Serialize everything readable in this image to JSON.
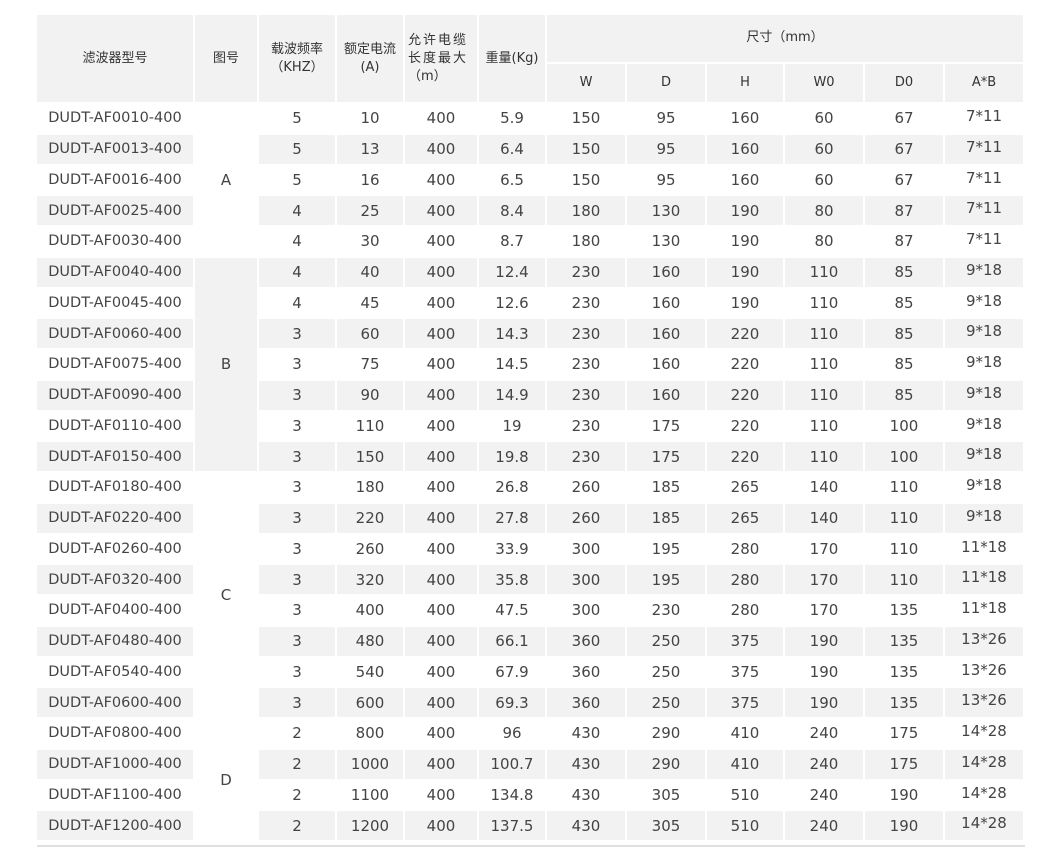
{
  "header": {
    "model": "滤波器型号",
    "figure": "图号",
    "carrier_freq": [
      "载波频率",
      "（KHZ）"
    ],
    "rated_current": [
      "额定电流",
      "(A)"
    ],
    "cable_length": [
      "允许电缆",
      "长度最大",
      "（m）"
    ],
    "weight": "重量(Kg)",
    "dimensions": "尺寸（mm）",
    "dim_cols": [
      "W",
      "D",
      "H",
      "W0",
      "D0",
      "A*B"
    ]
  },
  "groups": [
    {
      "label": "A",
      "start": 0,
      "span": 5
    },
    {
      "label": "B",
      "start": 5,
      "span": 7
    },
    {
      "label": "C",
      "start": 12,
      "span": 8
    },
    {
      "label": "D",
      "start": 20,
      "span": 4
    }
  ],
  "rows": [
    {
      "model": "DUDT-AF0010-400",
      "freq": "5",
      "current": "10",
      "cable": "400",
      "weight": "5.9",
      "W": "150",
      "D": "95",
      "H": "160",
      "W0": "60",
      "D0": "67",
      "AB": "7*11"
    },
    {
      "model": "DUDT-AF0013-400",
      "freq": "5",
      "current": "13",
      "cable": "400",
      "weight": "6.4",
      "W": "150",
      "D": "95",
      "H": "160",
      "W0": "60",
      "D0": "67",
      "AB": "7*11"
    },
    {
      "model": "DUDT-AF0016-400",
      "freq": "5",
      "current": "16",
      "cable": "400",
      "weight": "6.5",
      "W": "150",
      "D": "95",
      "H": "160",
      "W0": "60",
      "D0": "67",
      "AB": "7*11"
    },
    {
      "model": "DUDT-AF0025-400",
      "freq": "4",
      "current": "25",
      "cable": "400",
      "weight": "8.4",
      "W": "180",
      "D": "130",
      "H": "190",
      "W0": "80",
      "D0": "87",
      "AB": "7*11"
    },
    {
      "model": "DUDT-AF0030-400",
      "freq": "4",
      "current": "30",
      "cable": "400",
      "weight": "8.7",
      "W": "180",
      "D": "130",
      "H": "190",
      "W0": "80",
      "D0": "87",
      "AB": "7*11"
    },
    {
      "model": "DUDT-AF0040-400",
      "freq": "4",
      "current": "40",
      "cable": "400",
      "weight": "12.4",
      "W": "230",
      "D": "160",
      "H": "190",
      "W0": "110",
      "D0": "85",
      "AB": "9*18"
    },
    {
      "model": "DUDT-AF0045-400",
      "freq": "4",
      "current": "45",
      "cable": "400",
      "weight": "12.6",
      "W": "230",
      "D": "160",
      "H": "190",
      "W0": "110",
      "D0": "85",
      "AB": "9*18"
    },
    {
      "model": "DUDT-AF0060-400",
      "freq": "3",
      "current": "60",
      "cable": "400",
      "weight": "14.3",
      "W": "230",
      "D": "160",
      "H": "220",
      "W0": "110",
      "D0": "85",
      "AB": "9*18"
    },
    {
      "model": "DUDT-AF0075-400",
      "freq": "3",
      "current": "75",
      "cable": "400",
      "weight": "14.5",
      "W": "230",
      "D": "160",
      "H": "220",
      "W0": "110",
      "D0": "85",
      "AB": "9*18"
    },
    {
      "model": "DUDT-AF0090-400",
      "freq": "3",
      "current": "90",
      "cable": "400",
      "weight": "14.9",
      "W": "230",
      "D": "160",
      "H": "220",
      "W0": "110",
      "D0": "85",
      "AB": "9*18"
    },
    {
      "model": "DUDT-AF0110-400",
      "freq": "3",
      "current": "110",
      "cable": "400",
      "weight": "19",
      "W": "230",
      "D": "175",
      "H": "220",
      "W0": "110",
      "D0": "100",
      "AB": "9*18"
    },
    {
      "model": "DUDT-AF0150-400",
      "freq": "3",
      "current": "150",
      "cable": "400",
      "weight": "19.8",
      "W": "230",
      "D": "175",
      "H": "220",
      "W0": "110",
      "D0": "100",
      "AB": "9*18"
    },
    {
      "model": "DUDT-AF0180-400",
      "freq": "3",
      "current": "180",
      "cable": "400",
      "weight": "26.8",
      "W": "260",
      "D": "185",
      "H": "265",
      "W0": "140",
      "D0": "110",
      "AB": "9*18"
    },
    {
      "model": "DUDT-AF0220-400",
      "freq": "3",
      "current": "220",
      "cable": "400",
      "weight": "27.8",
      "W": "260",
      "D": "185",
      "H": "265",
      "W0": "140",
      "D0": "110",
      "AB": "9*18"
    },
    {
      "model": "DUDT-AF0260-400",
      "freq": "3",
      "current": "260",
      "cable": "400",
      "weight": "33.9",
      "W": "300",
      "D": "195",
      "H": "280",
      "W0": "170",
      "D0": "110",
      "AB": "11*18"
    },
    {
      "model": "DUDT-AF0320-400",
      "freq": "3",
      "current": "320",
      "cable": "400",
      "weight": "35.8",
      "W": "300",
      "D": "195",
      "H": "280",
      "W0": "170",
      "D0": "110",
      "AB": "11*18"
    },
    {
      "model": "DUDT-AF0400-400",
      "freq": "3",
      "current": "400",
      "cable": "400",
      "weight": "47.5",
      "W": "300",
      "D": "230",
      "H": "280",
      "W0": "170",
      "D0": "135",
      "AB": "11*18"
    },
    {
      "model": "DUDT-AF0480-400",
      "freq": "3",
      "current": "480",
      "cable": "400",
      "weight": "66.1",
      "W": "360",
      "D": "250",
      "H": "375",
      "W0": "190",
      "D0": "135",
      "AB": "13*26"
    },
    {
      "model": "DUDT-AF0540-400",
      "freq": "3",
      "current": "540",
      "cable": "400",
      "weight": "67.9",
      "W": "360",
      "D": "250",
      "H": "375",
      "W0": "190",
      "D0": "135",
      "AB": "13*26"
    },
    {
      "model": "DUDT-AF0600-400",
      "freq": "3",
      "current": "600",
      "cable": "400",
      "weight": "69.3",
      "W": "360",
      "D": "250",
      "H": "375",
      "W0": "190",
      "D0": "135",
      "AB": "13*26"
    },
    {
      "model": "DUDT-AF0800-400",
      "freq": "2",
      "current": "800",
      "cable": "400",
      "weight": "96",
      "W": "430",
      "D": "290",
      "H": "410",
      "W0": "240",
      "D0": "175",
      "AB": "14*28"
    },
    {
      "model": "DUDT-AF1000-400",
      "freq": "2",
      "current": "1000",
      "cable": "400",
      "weight": "100.7",
      "W": "430",
      "D": "290",
      "H": "410",
      "W0": "240",
      "D0": "175",
      "AB": "14*28"
    },
    {
      "model": "DUDT-AF1100-400",
      "freq": "2",
      "current": "1100",
      "cable": "400",
      "weight": "134.8",
      "W": "430",
      "D": "305",
      "H": "510",
      "W0": "240",
      "D0": "190",
      "AB": "14*28"
    },
    {
      "model": "DUDT-AF1200-400",
      "freq": "2",
      "current": "1200",
      "cable": "400",
      "weight": "137.5",
      "W": "430",
      "D": "305",
      "H": "510",
      "W0": "240",
      "D0": "190",
      "AB": "14*28"
    }
  ]
}
